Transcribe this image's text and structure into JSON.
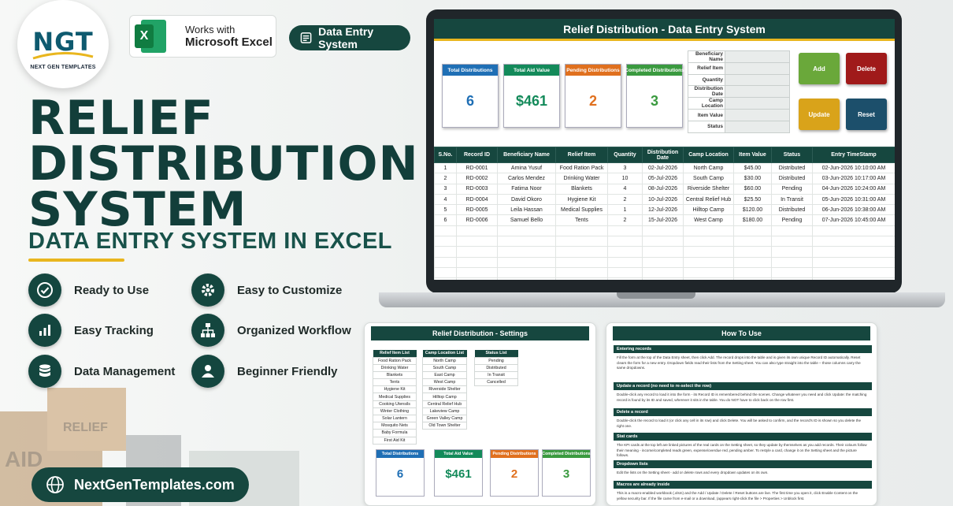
{
  "brand": {
    "logo_text": "NGT",
    "logo_subtitle": "NEXT GEN TEMPLATES",
    "excel_line1": "Works with",
    "excel_line2": "Microsoft Excel",
    "excel_glyph": "X",
    "pill": "Data Entry System",
    "website": "NextGenTemplates.com",
    "accent": "#e9b61e",
    "primary": "#16473f"
  },
  "hero": {
    "line1": "RELIEF",
    "line2": "DISTRIBUTION",
    "line3": "SYSTEM",
    "subtitle": "DATA ENTRY SYSTEM IN EXCEL"
  },
  "features": [
    {
      "label": "Ready to Use",
      "icon": "check-circle-icon"
    },
    {
      "label": "Easy to Customize",
      "icon": "gear-icon"
    },
    {
      "label": "Easy Tracking",
      "icon": "bar-chart-icon"
    },
    {
      "label": "Organized Workflow",
      "icon": "org-chart-icon"
    },
    {
      "label": "Data Management",
      "icon": "database-icon"
    },
    {
      "label": "Beginner Friendly",
      "icon": "user-icon"
    }
  ],
  "sheet": {
    "title": "Relief Distribution - Data Entry System",
    "kpis": [
      {
        "label": "Total Distributions",
        "value": "6",
        "color": "#1f6fb5"
      },
      {
        "label": "Total Aid Value",
        "value": "$461",
        "color": "#138a5a"
      },
      {
        "label": "Pending Distributions",
        "value": "2",
        "color": "#e0701e"
      },
      {
        "label": "Completed Distributions",
        "value": "3",
        "color": "#3a9a3f"
      }
    ],
    "form_labels": [
      "Beneficiary Name",
      "Relief Item",
      "Quantity",
      "Distribution Date",
      "Camp Location",
      "Item Value",
      "Status"
    ],
    "buttons": {
      "add": "Add",
      "delete": "Delete",
      "update": "Update",
      "reset": "Reset"
    },
    "columns": [
      "S.No.",
      "Record ID",
      "Beneficiary Name",
      "Relief Item",
      "Quantity",
      "Distribution Date",
      "Camp Location",
      "Item Value",
      "Status",
      "Entry TimeStamp"
    ],
    "rows": [
      [
        "1",
        "RD-0001",
        "Amina Yusuf",
        "Food Ration Pack",
        "3",
        "02-Jul-2026",
        "North Camp",
        "$45.00",
        "Distributed",
        "02-Jun-2026 10:10:00 AM"
      ],
      [
        "2",
        "RD-0002",
        "Carlos Mendez",
        "Drinking Water",
        "10",
        "05-Jul-2026",
        "South Camp",
        "$30.00",
        "Distributed",
        "03-Jun-2026 10:17:00 AM"
      ],
      [
        "3",
        "RD-0003",
        "Fatima Noor",
        "Blankets",
        "4",
        "08-Jul-2026",
        "Riverside Shelter",
        "$60.00",
        "Pending",
        "04-Jun-2026 10:24:00 AM"
      ],
      [
        "4",
        "RD-0004",
        "David Okoro",
        "Hygiene Kit",
        "2",
        "10-Jul-2026",
        "Central Relief Hub",
        "$25.50",
        "In Transit",
        "05-Jun-2026 10:31:00 AM"
      ],
      [
        "5",
        "RD-0005",
        "Leila Hassan",
        "Medical Supplies",
        "1",
        "12-Jul-2026",
        "Hilltop Camp",
        "$120.00",
        "Distributed",
        "06-Jun-2026 10:38:00 AM"
      ],
      [
        "6",
        "RD-0006",
        "Samuel Bello",
        "Tents",
        "2",
        "15-Jul-2026",
        "West Camp",
        "$180.00",
        "Pending",
        "07-Jun-2026 10:45:00 AM"
      ]
    ]
  },
  "settings": {
    "title": "Relief Distribution - Settings",
    "lists": [
      {
        "header": "Relief Item List",
        "items": [
          "Food Ration Pack",
          "Drinking Water",
          "Blankets",
          "Tents",
          "Hygiene Kit",
          "Medical Supplies",
          "Cooking Utensils",
          "Winter Clothing",
          "Solar Lantern",
          "Mosquito Nets",
          "Baby Formula",
          "First Aid Kit"
        ]
      },
      {
        "header": "Camp Location List",
        "items": [
          "North Camp",
          "South Camp",
          "East Camp",
          "West Camp",
          "Riverside Shelter",
          "Hilltop Camp",
          "Central Relief Hub",
          "Lakeview Camp",
          "Green Valley Camp",
          "Old Town Shelter"
        ]
      },
      {
        "header": "Status List",
        "items": [
          "Pending",
          "Distributed",
          "In Transit",
          "Cancelled"
        ]
      }
    ],
    "kpis": [
      {
        "label": "Total Distributions",
        "value": "6"
      },
      {
        "label": "Total Aid Value",
        "value": "$461"
      },
      {
        "label": "Pending Distributions",
        "value": "2"
      },
      {
        "label": "Completed Distributions",
        "value": "3"
      }
    ]
  },
  "howto": {
    "title": "How To Use",
    "sections": [
      {
        "heading": "Entering records",
        "body": "Fill the form at the top of the Data Entry sheet, then click Add. The record drops into the table and is given its own unique Record ID automatically. Reset clears the form for a new entry. Dropdown fields read their lists from the Setting sheet. You can also type straight into the table – those columns carry the same dropdowns."
      },
      {
        "heading": "Update a record (no need to re-select the row)",
        "body": "Double-click any record to load it into the form - its Record ID is remembered behind the scenes. Change whatever you need and click Update: the matching record is found by its ID and saved, wherever it sits in the table. You do NOT have to click back on the row first."
      },
      {
        "heading": "Delete a record",
        "body": "Double-click the record to load it (or click any cell in its row) and click Delete. You will be asked to confirm, and the record's ID is shown so you delete the right one."
      },
      {
        "heading": "Stat cards",
        "body": "The KPI cards at the top left are linked pictures of the real cards on the Setting sheet, so they update by themselves as you add records. Their colours follow their meaning - income/completed reads green, expense/overdue red, pending amber. To restyle a card, change it on the Setting sheet and the picture follows."
      },
      {
        "heading": "Dropdown lists",
        "body": "Edit the lists on the Setting sheet - add or delete rows and every dropdown updates on its own."
      },
      {
        "heading": "Macros are already inside",
        "body": "This is a macro-enabled workbook (.xlsm) and the Add / Update / Delete / Reset buttons are live. The first time you open it, click Enable Content on the yellow security bar. If the file came from e-mail or a download, (appears right-click the file > Properties > Unblock first."
      }
    ]
  }
}
